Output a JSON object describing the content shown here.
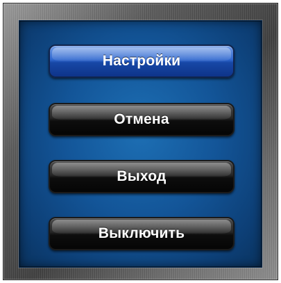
{
  "menu": {
    "items": [
      {
        "label": "Настройки",
        "state": "highlighted"
      },
      {
        "label": "Отмена",
        "state": "normal"
      },
      {
        "label": "Выход",
        "state": "normal"
      },
      {
        "label": "Выключить",
        "state": "normal"
      }
    ]
  },
  "colors": {
    "panel": "#135598",
    "highlight_button": "#2f67cf",
    "normal_button": "#1a1a1a",
    "frame": "#5a5a5a",
    "text": "#ffffff"
  }
}
